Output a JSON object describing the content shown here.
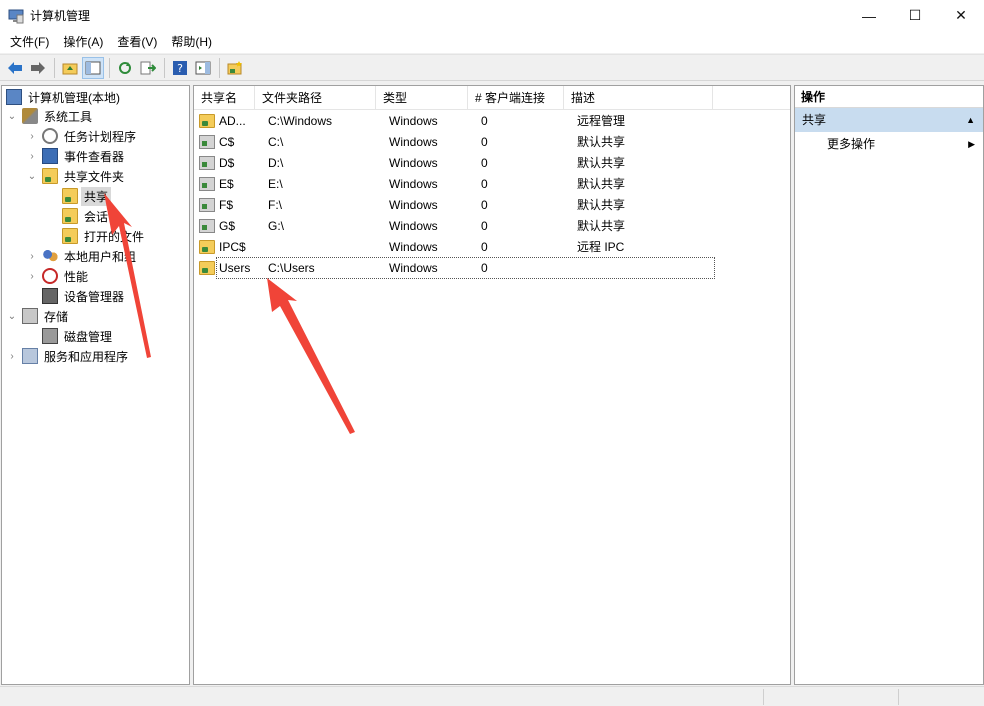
{
  "window": {
    "title": "计算机管理",
    "minimize": "—",
    "maximize": "☐",
    "close": "✕"
  },
  "menu": [
    "文件(F)",
    "操作(A)",
    "查看(V)",
    "帮助(H)"
  ],
  "tree": {
    "root": "计算机管理(本地)",
    "system_tools": "系统工具",
    "task_scheduler": "任务计划程序",
    "event_viewer": "事件查看器",
    "shared_folders": "共享文件夹",
    "shares": "共享",
    "sessions": "会话",
    "open_files": "打开的文件",
    "local_users": "本地用户和组",
    "performance": "性能",
    "device_manager": "设备管理器",
    "storage": "存储",
    "disk_management": "磁盘管理",
    "services_apps": "服务和应用程序"
  },
  "table": {
    "columns": [
      "共享名",
      "文件夹路径",
      "类型",
      "# 客户端连接",
      "描述"
    ],
    "rows": [
      {
        "name": "AD...",
        "path": "C:\\Windows",
        "type": "Windows",
        "clients": "0",
        "desc": "远程管理",
        "icon": "folder-share"
      },
      {
        "name": "C$",
        "path": "C:\\",
        "type": "Windows",
        "clients": "0",
        "desc": "默认共享",
        "icon": "drive-share"
      },
      {
        "name": "D$",
        "path": "D:\\",
        "type": "Windows",
        "clients": "0",
        "desc": "默认共享",
        "icon": "drive-share"
      },
      {
        "name": "E$",
        "path": "E:\\",
        "type": "Windows",
        "clients": "0",
        "desc": "默认共享",
        "icon": "drive-share"
      },
      {
        "name": "F$",
        "path": "F:\\",
        "type": "Windows",
        "clients": "0",
        "desc": "默认共享",
        "icon": "drive-share"
      },
      {
        "name": "G$",
        "path": "G:\\",
        "type": "Windows",
        "clients": "0",
        "desc": "默认共享",
        "icon": "drive-share"
      },
      {
        "name": "IPC$",
        "path": "",
        "type": "Windows",
        "clients": "0",
        "desc": "远程 IPC",
        "icon": "folder-share"
      },
      {
        "name": "Users",
        "path": "C:\\Users",
        "type": "Windows",
        "clients": "0",
        "desc": "",
        "icon": "folder-share"
      }
    ]
  },
  "actions": {
    "header": "操作",
    "section": "共享",
    "more": "更多操作"
  },
  "colors": {
    "arrow": "#f04438",
    "selection": "#c8dcef"
  }
}
